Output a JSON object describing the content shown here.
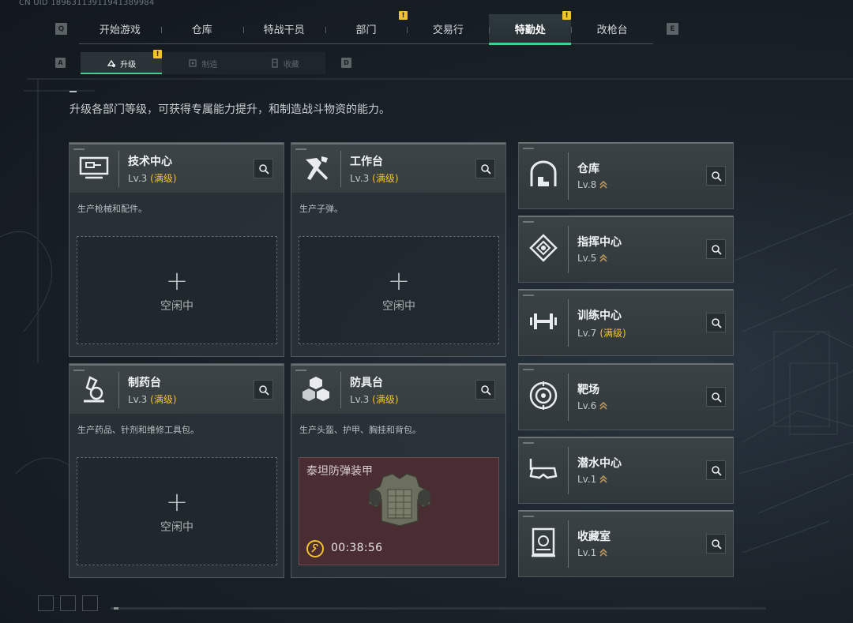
{
  "uid": "CN UID 18963113911941389984",
  "nav_keys": {
    "left": "Q",
    "right": "E",
    "sub_left": "A",
    "sub_right": "D"
  },
  "top_tabs": [
    {
      "label": "开始游戏",
      "active": false,
      "warning": false
    },
    {
      "label": "仓库",
      "active": false,
      "warning": false
    },
    {
      "label": "特战干员",
      "active": false,
      "warning": false
    },
    {
      "label": "部门",
      "active": false,
      "warning": true
    },
    {
      "label": "交易行",
      "active": false,
      "warning": false
    },
    {
      "label": "特勤处",
      "active": true,
      "warning": true
    },
    {
      "label": "改枪台",
      "active": false,
      "warning": false
    }
  ],
  "sub_tabs": [
    {
      "label": "升级",
      "active": true,
      "warning": true,
      "icon": "upgrade-icon"
    },
    {
      "label": "制造",
      "active": false,
      "warning": false,
      "icon": "craft-icon"
    },
    {
      "label": "收藏",
      "active": false,
      "warning": false,
      "icon": "collection-icon"
    }
  ],
  "warning_glyph": "!",
  "description": "升级各部门等级，可获得专属能力提升，和制造战斗物资的能力。",
  "cards": [
    {
      "name": "技术中心",
      "level": "Lv.3",
      "max_label": "(满级)",
      "desc": "生产枪械和配件。",
      "icon": "computer-icon",
      "plus": "+",
      "idle": "空闲中"
    },
    {
      "name": "工作台",
      "level": "Lv.3",
      "max_label": "(满级)",
      "desc": "生产子弹。",
      "icon": "tools-icon",
      "plus": "+",
      "idle": "空闲中"
    },
    {
      "name": "制药台",
      "level": "Lv.3",
      "max_label": "(满级)",
      "desc": "生产药品、针剂和维修工具包。",
      "icon": "microscope-icon",
      "plus": "+",
      "idle": "空闲中"
    },
    {
      "name": "防具台",
      "level": "Lv.3",
      "max_label": "(满级)",
      "desc": "生产头盔、护甲、胸挂和背包。",
      "icon": "cubes-icon",
      "crafting": {
        "item": "泰坦防弹装甲",
        "timer": "00:38:56"
      }
    }
  ],
  "facilities": [
    {
      "name": "仓库",
      "level": "Lv.8",
      "max_label": "",
      "upgradable": true,
      "icon": "warehouse-icon"
    },
    {
      "name": "指挥中心",
      "level": "Lv.5",
      "max_label": "",
      "upgradable": true,
      "icon": "command-icon"
    },
    {
      "name": "训练中心",
      "level": "Lv.7",
      "max_label": "(满级)",
      "upgradable": false,
      "icon": "dumbbell-icon"
    },
    {
      "name": "靶场",
      "level": "Lv.6",
      "max_label": "",
      "upgradable": true,
      "icon": "target-icon"
    },
    {
      "name": "潜水中心",
      "level": "Lv.1",
      "max_label": "",
      "upgradable": true,
      "icon": "diving-mask-icon"
    },
    {
      "name": "收藏室",
      "level": "Lv.1",
      "max_label": "",
      "upgradable": true,
      "icon": "collection-room-icon"
    }
  ],
  "colors": {
    "accent": "#3fd08f",
    "warning": "#f2c230",
    "craft_bg": "#4a2d33"
  }
}
